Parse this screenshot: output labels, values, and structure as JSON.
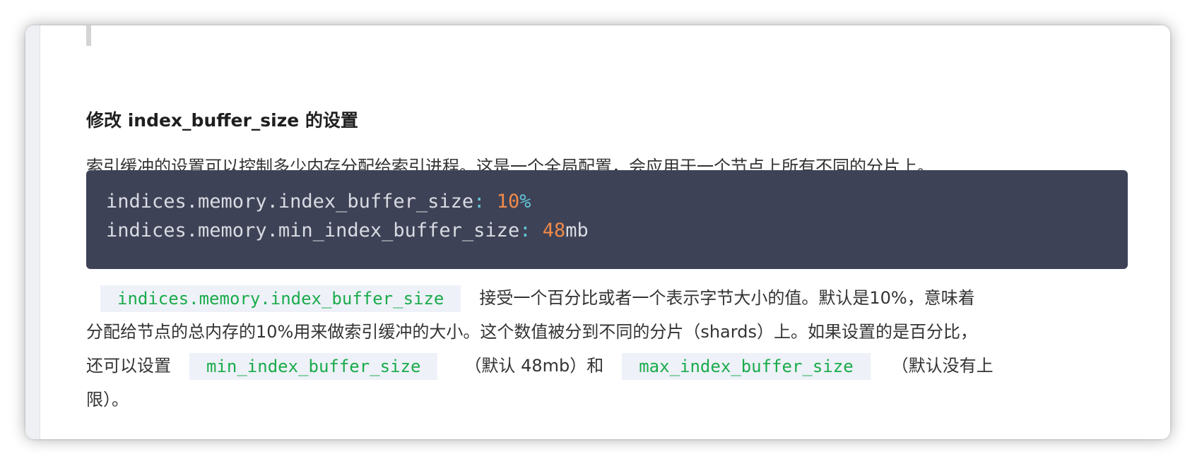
{
  "heading": "修改 index_buffer_size 的设置",
  "intro": "索引缓冲的设置可以控制多少内存分配给索引进程。这是一个全局配置，会应用于一个节点上所有不同的分片上。",
  "code": {
    "line1": {
      "key": "indices.memory.index_buffer_size",
      "colon": ":",
      "number": "10",
      "unit": "%"
    },
    "line2": {
      "key": "indices.memory.min_index_buffer_size",
      "colon": ":",
      "number": "48",
      "unit": "mb"
    }
  },
  "explanation": {
    "code1": "indices.memory.index_buffer_size",
    "text1": "接受一个百分比或者一个表示字节大小的值。默认是10%，意味着",
    "text2": "分配给节点的总内存的10%用来做索引缓冲的大小。这个数值被分到不同的分片（shards）上。如果设置的是百分比，",
    "text3a": "还可以设置",
    "code2": "min_index_buffer_size",
    "text3b": "（默认 48mb）和",
    "code3": "max_index_buffer_size",
    "text3c": "（默认没有上",
    "text4": "限）。"
  },
  "colors": {
    "code_bg": "#3e4256",
    "code_text": "#d9dbe3",
    "code_number": "#f08a4a",
    "code_punct": "#63c5d6",
    "inline_code_text": "#1aab4b",
    "inline_code_bg": "#eef1f8"
  }
}
